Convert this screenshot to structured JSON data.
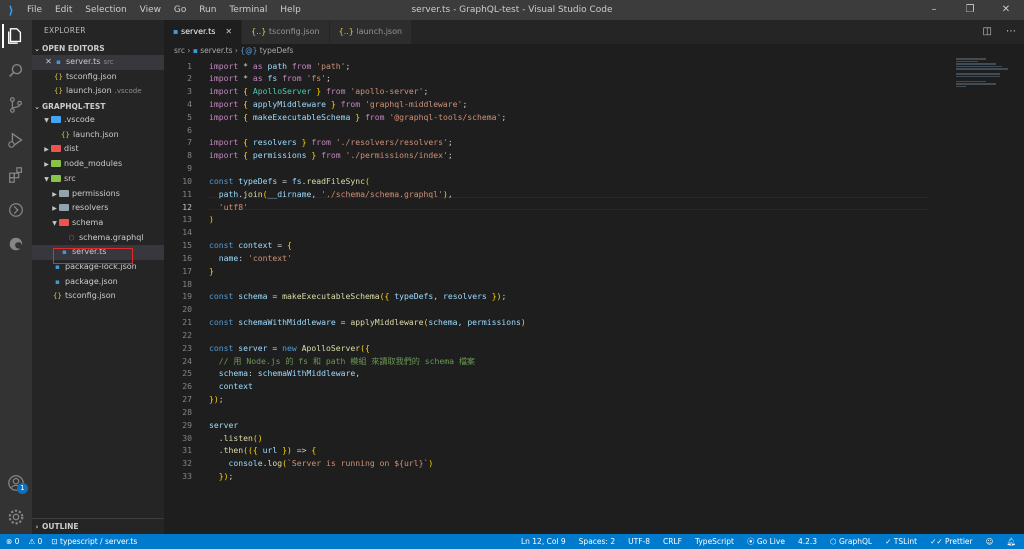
{
  "window": {
    "title": "server.ts - GraphQL-test - Visual Studio Code",
    "menu": [
      "File",
      "Edit",
      "Selection",
      "View",
      "Go",
      "Run",
      "Terminal",
      "Help"
    ]
  },
  "sidebar": {
    "header": "EXPLORER",
    "open_editors": {
      "title": "OPEN EDITORS",
      "items": [
        {
          "name": "server.ts",
          "hint": "src"
        },
        {
          "name": "tsconfig.json",
          "hint": ""
        },
        {
          "name": "launch.json",
          "hint": ".vscode"
        }
      ]
    },
    "workspace": {
      "title": "GRAPHQL-TEST",
      "tree": [
        {
          "name": ".vscode"
        },
        {
          "name": "launch.json"
        },
        {
          "name": "dist"
        },
        {
          "name": "node_modules"
        },
        {
          "name": "src"
        },
        {
          "name": "permissions"
        },
        {
          "name": "resolvers"
        },
        {
          "name": "schema"
        },
        {
          "name": "schema.graphql"
        },
        {
          "name": "server.ts"
        },
        {
          "name": "package-lock.json"
        },
        {
          "name": "package.json"
        },
        {
          "name": "tsconfig.json"
        }
      ]
    },
    "outline": "OUTLINE"
  },
  "tabs": [
    {
      "label": "server.ts",
      "active": true
    },
    {
      "label": "tsconfig.json",
      "active": false
    },
    {
      "label": "launch.json",
      "active": false
    }
  ],
  "breadcrumb": {
    "folder": "src",
    "file": "server.ts",
    "symbol": "typeDefs"
  },
  "editor": {
    "current_line": 12,
    "lines": [
      "import * as path from 'path';",
      "import * as fs from 'fs';",
      "import { ApolloServer } from 'apollo-server';",
      "import { applyMiddleware } from 'graphql-middleware';",
      "import { makeExecutableSchema } from '@graphql-tools/schema';",
      "",
      "import { resolvers } from './resolvers/resolvers';",
      "import { permissions } from './permissions/index';",
      "",
      "const typeDefs = fs.readFileSync(",
      "  path.join(__dirname, './schema/schema.graphql'),",
      "  'utf8'",
      ")",
      "",
      "const context = {",
      "  name: 'context'",
      "}",
      "",
      "const schema = makeExecutableSchema({ typeDefs, resolvers });",
      "",
      "const schemaWithMiddleware = applyMiddleware(schema, permissions)",
      "",
      "const server = new ApolloServer({",
      "  // 用 Node.js 的 fs 和 path 模組 來讀取我們的 schema 檔案",
      "  schema: schemaWithMiddleware,",
      "  context",
      "});",
      "",
      "server",
      "  .listen()",
      "  .then(({ url }) => {",
      "    console.log(`Server is running on ${url}`)",
      "  });"
    ]
  },
  "statusbar": {
    "left": [
      "⊗ 0",
      "⚠ 0",
      "typescript",
      "server.ts"
    ],
    "right": [
      "Ln 12, Col 9",
      "Spaces: 2",
      "UTF-8",
      "CRLF",
      "TypeScript",
      "Go Live",
      "4.2.3",
      "GraphQL",
      "TSLint",
      "Prettier"
    ]
  },
  "colors": {
    "statusbar": "#007acc",
    "activitybar": "#333333",
    "sidebar": "#252526",
    "editor": "#1e1e1e"
  }
}
